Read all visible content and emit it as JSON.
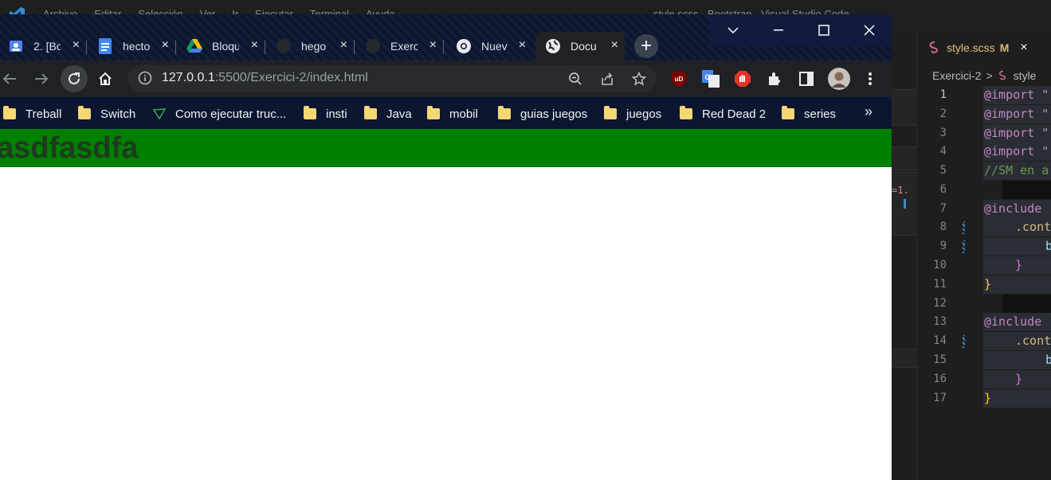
{
  "vscode": {
    "menu": [
      "Archivo",
      "Editar",
      "Selección",
      "Ver",
      "Ir",
      "Ejecutar",
      "Terminal",
      "Ayuda"
    ],
    "window_title": "style.scss - Bootstrap - Visual Studio Code",
    "tab": {
      "label": "style.scss",
      "badge": "M",
      "close": "×"
    },
    "breadcrumb": {
      "folder": "Exercici-2",
      "separator": ">",
      "file": "style"
    },
    "left_fragment": "=1.",
    "lines": [
      {
        "num": "1",
        "text": "@import \""
      },
      {
        "num": "2",
        "text": "@import \""
      },
      {
        "num": "3",
        "text": "@import \""
      },
      {
        "num": "4",
        "text": "@import \""
      },
      {
        "num": "5",
        "text": "//SM en a"
      },
      {
        "num": "6",
        "text": ""
      },
      {
        "num": "7",
        "text": "@include"
      },
      {
        "num": "8",
        "text": ".cont"
      },
      {
        "num": "9",
        "text": "b"
      },
      {
        "num": "10",
        "text": "}"
      },
      {
        "num": "11",
        "text": "}"
      },
      {
        "num": "12",
        "text": ""
      },
      {
        "num": "13",
        "text": "@include"
      },
      {
        "num": "14",
        "text": ".cont"
      },
      {
        "num": "15",
        "text": "b"
      },
      {
        "num": "16",
        "text": "}"
      },
      {
        "num": "17",
        "text": "}"
      }
    ]
  },
  "chrome": {
    "tabs": [
      {
        "label": "2. [Bo",
        "icon": "contacts-icon",
        "active": false
      },
      {
        "label": "hecto",
        "icon": "docs-icon",
        "active": false
      },
      {
        "label": "Bloqu",
        "icon": "drive-icon",
        "active": false
      },
      {
        "label": "hego",
        "icon": "github-icon",
        "active": false
      },
      {
        "label": "Exerc",
        "icon": "github-icon",
        "active": false
      },
      {
        "label": "Nuev",
        "icon": "chrome-icon",
        "active": false
      },
      {
        "label": "Docu",
        "icon": "globe-icon",
        "active": true
      }
    ],
    "tab_close": "×",
    "new_tab": "+",
    "address": {
      "host": "127.0.0.1",
      "rest": ":5500/Exercici-2/index.html"
    },
    "extensions": {
      "ublock": "uD",
      "translate": "G"
    },
    "bookmarks": [
      {
        "label": "Treball",
        "icon": "folder-icon"
      },
      {
        "label": "Switch",
        "icon": "folder-icon"
      },
      {
        "label": "Como ejecutar truc...",
        "icon": "page-icon"
      },
      {
        "label": "insti",
        "icon": "folder-icon"
      },
      {
        "label": "Java",
        "icon": "folder-icon"
      },
      {
        "label": "mobil",
        "icon": "folder-icon"
      },
      {
        "label": "guias juegos",
        "icon": "folder-icon"
      },
      {
        "label": "juegos",
        "icon": "folder-icon"
      },
      {
        "label": "Red Dead 2",
        "icon": "folder-icon"
      },
      {
        "label": "series",
        "icon": "folder-icon"
      }
    ],
    "bookmarks_more": "»"
  },
  "page": {
    "heading": "asdfasdfa",
    "banner_color": "#008000"
  }
}
